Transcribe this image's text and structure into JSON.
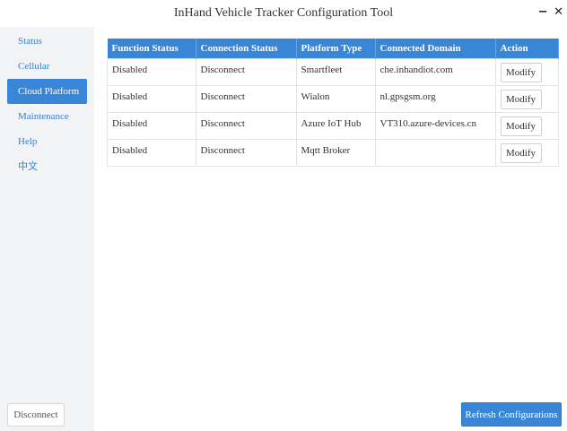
{
  "window": {
    "title": "InHand Vehicle Tracker Configuration Tool",
    "minimize_label": "−",
    "close_label": "✕"
  },
  "sidebar": {
    "items": [
      {
        "label": "Status"
      },
      {
        "label": "Cellular"
      },
      {
        "label": "Cloud Platform",
        "active": true
      },
      {
        "label": "Maintenance"
      },
      {
        "label": "Help"
      },
      {
        "label": "中文"
      }
    ],
    "disconnect_label": "Disconnect"
  },
  "table": {
    "headers": [
      "Function Status",
      "Connection Status",
      "Platform Type",
      "Connected Domain",
      "Action"
    ],
    "rows": [
      {
        "function_status": "Disabled",
        "connection_status": "Disconnect",
        "platform_type": "Smartfleet",
        "domain": "che.inhandiot.com",
        "action": "Modify"
      },
      {
        "function_status": "Disabled",
        "connection_status": "Disconnect",
        "platform_type": "Wialon",
        "domain": "nl.gpsgsm.org",
        "action": "Modify"
      },
      {
        "function_status": "Disabled",
        "connection_status": "Disconnect",
        "platform_type": "Azure IoT Hub",
        "domain": "VT310.azure-devices.cn",
        "action": "Modify"
      },
      {
        "function_status": "Disabled",
        "connection_status": "Disconnect",
        "platform_type": "Mqtt Broker",
        "domain": "",
        "action": "Modify"
      }
    ]
  },
  "footer": {
    "refresh_label": "Refresh Configurations"
  },
  "colors": {
    "accent": "#3a86d6",
    "sidebar_bg": "#f2f3f5",
    "link": "#3b7fc4"
  }
}
